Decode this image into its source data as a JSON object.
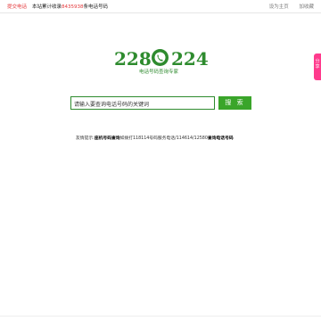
{
  "topbar": {
    "submit_label": "提交电话",
    "stat_prefix": "本站累计收录",
    "stat_count": "8435938",
    "stat_suffix": "条电话号码",
    "set_home": "设为主页",
    "add_fav": "加收藏"
  },
  "share_tab": {
    "label": "分享"
  },
  "logo": {
    "digits_left": "228",
    "digits_right": "224",
    "tagline": "电话号码查询专家",
    "icon": "phone-handset-icon"
  },
  "search": {
    "placeholder": "请输入要查询电话号码的关键词",
    "button_label": "搜 索"
  },
  "tip": {
    "prefix": "友情提示:",
    "bold1": "座机号码查询",
    "mid": "如拨打118114号码服务电话/114614/12580",
    "bold2": "查询电话号码"
  },
  "colors": {
    "brand_green": "#2e8b2e",
    "button_green": "#3aa52a",
    "accent_red": "#e4393c",
    "share_pink": "#ff3b8d"
  }
}
